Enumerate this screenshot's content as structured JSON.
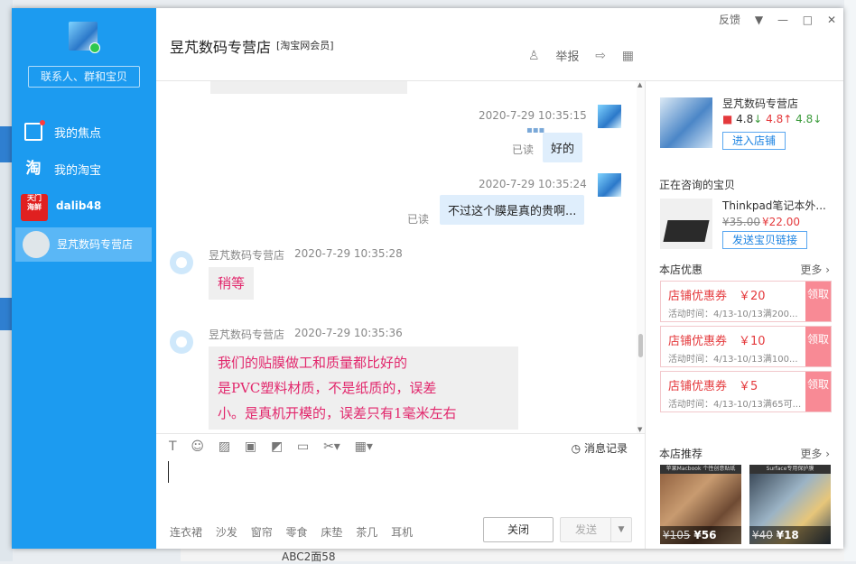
{
  "sidebar": {
    "search_label": "联系人、群和宝贝",
    "items": [
      {
        "label": "我的焦点"
      },
      {
        "label": "我的淘宝"
      },
      {
        "label": "dalib48",
        "icon_text": "天门\n海鲜"
      },
      {
        "label": "昱芃数码专营店"
      }
    ]
  },
  "header": {
    "shop_name": "昱芃数码专营店",
    "member_badge": "[淘宝网会员]",
    "feedback": "反馈",
    "report": "举报"
  },
  "chat": {
    "messages": [
      {
        "time": "2020-7-29 10:35:15",
        "text": "好的",
        "status": "已读"
      },
      {
        "time": "2020-7-29 10:35:24",
        "text": "不过这个膜是真的贵啊...",
        "status": "已读"
      },
      {
        "sender": "昱芃数码专营店",
        "time": "2020-7-29 10:35:28",
        "text": "稍等"
      },
      {
        "sender": "昱芃数码专营店",
        "time": "2020-7-29 10:35:36",
        "lines": [
          "我们的贴膜做工和质量都比好的",
          "是PVC塑料材质，不是纸质的，误差",
          "小。是真机开模的，误差只有1毫米左右"
        ]
      }
    ]
  },
  "input": {
    "history_label": "消息记录",
    "quick_words": [
      "连衣裙",
      "沙发",
      "窗帘",
      "零食",
      "床垫",
      "茶几",
      "耳机"
    ],
    "close_label": "关闭",
    "send_label": "发送"
  },
  "rpanel": {
    "shop_name": "昱芃数码专营店",
    "score1": "4.8",
    "score2": "4.8",
    "score3": "4.8",
    "enter_label": "进入店铺",
    "consulting_title": "正在咨询的宝贝",
    "product_name": "Thinkpad笔记本外...",
    "old_price": "¥35.00",
    "new_price": "¥22.00",
    "send_link_label": "发送宝贝链接",
    "coupons_title": "本店优惠",
    "more_label": "更多",
    "coupons": [
      {
        "title": "店铺优惠券　￥20",
        "time": "活动时间：4/13-10/13满200...",
        "claim": "领取"
      },
      {
        "title": "店铺优惠券　￥10",
        "time": "活动时间：4/13-10/13满100...",
        "claim": "领取"
      },
      {
        "title": "店铺优惠券　￥5",
        "time": "活动时间：4/13-10/13满65可...",
        "claim": "领取"
      }
    ],
    "rec_title": "本店推荐",
    "recs": [
      {
        "banner": "苹果Macbook 个性创意贴纸",
        "old": "¥105",
        "new": "¥56"
      },
      {
        "banner": "Surface专用保护膜",
        "old": "¥40",
        "new": "¥18"
      }
    ]
  },
  "desktop": {
    "bottom_text": "ABC2面58"
  },
  "colors": {
    "sidebar_bg": "#1c9bf0",
    "accent": "#1a82e2",
    "price_red": "#e4393c",
    "incoming_text": "#e2276c"
  }
}
